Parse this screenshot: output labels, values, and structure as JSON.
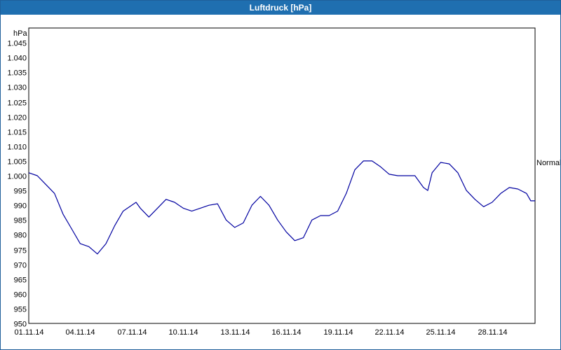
{
  "window": {
    "title": "Luftdruck [hPa]"
  },
  "chart_data": {
    "type": "line",
    "title": "Luftdruck [hPa]",
    "unit_label": "hPa",
    "ylim": [
      950,
      1050
    ],
    "y_ticks": [
      "950",
      "955",
      "960",
      "965",
      "970",
      "975",
      "980",
      "985",
      "990",
      "995",
      "1.000",
      "1.005",
      "1.010",
      "1.015",
      "1.020",
      "1.025",
      "1.030",
      "1.035",
      "1.040",
      "1.045"
    ],
    "x_range": [
      "2014-11-01T00:00",
      "2014-11-30T12:00"
    ],
    "x_ticks": [
      {
        "date": "2014-11-01",
        "label": "01.11.14"
      },
      {
        "date": "2014-11-04",
        "label": "04.11.14"
      },
      {
        "date": "2014-11-07",
        "label": "07.11.14"
      },
      {
        "date": "2014-11-10",
        "label": "10.11.14"
      },
      {
        "date": "2014-11-13",
        "label": "13.11.14"
      },
      {
        "date": "2014-11-16",
        "label": "16.11.14"
      },
      {
        "date": "2014-11-19",
        "label": "19.11.14"
      },
      {
        "date": "2014-11-22",
        "label": "22.11.14"
      },
      {
        "date": "2014-11-25",
        "label": "25.11.14"
      },
      {
        "date": "2014-11-28",
        "label": "28.11.14"
      }
    ],
    "grid": true,
    "annotation": {
      "label": "Normal",
      "value": 1004.5
    },
    "series": [
      {
        "color": "#0000a0",
        "points": [
          [
            "2014-11-01T00:00",
            1001
          ],
          [
            "2014-11-01T12:00",
            1000
          ],
          [
            "2014-11-02T00:00",
            997
          ],
          [
            "2014-11-02T12:00",
            994
          ],
          [
            "2014-11-03T00:00",
            987
          ],
          [
            "2014-11-03T12:00",
            982
          ],
          [
            "2014-11-04T00:00",
            977
          ],
          [
            "2014-11-04T12:00",
            976
          ],
          [
            "2014-11-05T00:00",
            973.5
          ],
          [
            "2014-11-05T12:00",
            977
          ],
          [
            "2014-11-06T00:00",
            983
          ],
          [
            "2014-11-06T12:00",
            988
          ],
          [
            "2014-11-07T00:00",
            990
          ],
          [
            "2014-11-07T06:00",
            991
          ],
          [
            "2014-11-07T12:00",
            989
          ],
          [
            "2014-11-08T00:00",
            986
          ],
          [
            "2014-11-08T12:00",
            989
          ],
          [
            "2014-11-09T00:00",
            992
          ],
          [
            "2014-11-09T12:00",
            991
          ],
          [
            "2014-11-10T00:00",
            989
          ],
          [
            "2014-11-10T12:00",
            988
          ],
          [
            "2014-11-11T00:00",
            989
          ],
          [
            "2014-11-11T12:00",
            990
          ],
          [
            "2014-11-12T00:00",
            990.5
          ],
          [
            "2014-11-12T12:00",
            985
          ],
          [
            "2014-11-13T00:00",
            982.5
          ],
          [
            "2014-11-13T12:00",
            984
          ],
          [
            "2014-11-14T00:00",
            990
          ],
          [
            "2014-11-14T12:00",
            993
          ],
          [
            "2014-11-15T00:00",
            990
          ],
          [
            "2014-11-15T12:00",
            985
          ],
          [
            "2014-11-16T00:00",
            981
          ],
          [
            "2014-11-16T12:00",
            978
          ],
          [
            "2014-11-17T00:00",
            979
          ],
          [
            "2014-11-17T12:00",
            985
          ],
          [
            "2014-11-18T00:00",
            986.5
          ],
          [
            "2014-11-18T12:00",
            986.5
          ],
          [
            "2014-11-19T00:00",
            988
          ],
          [
            "2014-11-19T12:00",
            994
          ],
          [
            "2014-11-20T00:00",
            1002
          ],
          [
            "2014-11-20T12:00",
            1005
          ],
          [
            "2014-11-21T00:00",
            1005
          ],
          [
            "2014-11-21T12:00",
            1003
          ],
          [
            "2014-11-22T00:00",
            1000.5
          ],
          [
            "2014-11-22T12:00",
            1000
          ],
          [
            "2014-11-23T00:00",
            1000
          ],
          [
            "2014-11-23T12:00",
            1000
          ],
          [
            "2014-11-24T00:00",
            996
          ],
          [
            "2014-11-24T06:00",
            995
          ],
          [
            "2014-11-24T12:00",
            1001
          ],
          [
            "2014-11-25T00:00",
            1004.5
          ],
          [
            "2014-11-25T12:00",
            1004
          ],
          [
            "2014-11-26T00:00",
            1001
          ],
          [
            "2014-11-26T12:00",
            995
          ],
          [
            "2014-11-27T00:00",
            992
          ],
          [
            "2014-11-27T12:00",
            989.5
          ],
          [
            "2014-11-28T00:00",
            991
          ],
          [
            "2014-11-28T12:00",
            994
          ],
          [
            "2014-11-29T00:00",
            996
          ],
          [
            "2014-11-29T12:00",
            995.5
          ],
          [
            "2014-11-30T00:00",
            994
          ],
          [
            "2014-11-30T06:00",
            991.5
          ],
          [
            "2014-11-30T12:00",
            991.5
          ]
        ]
      }
    ]
  }
}
